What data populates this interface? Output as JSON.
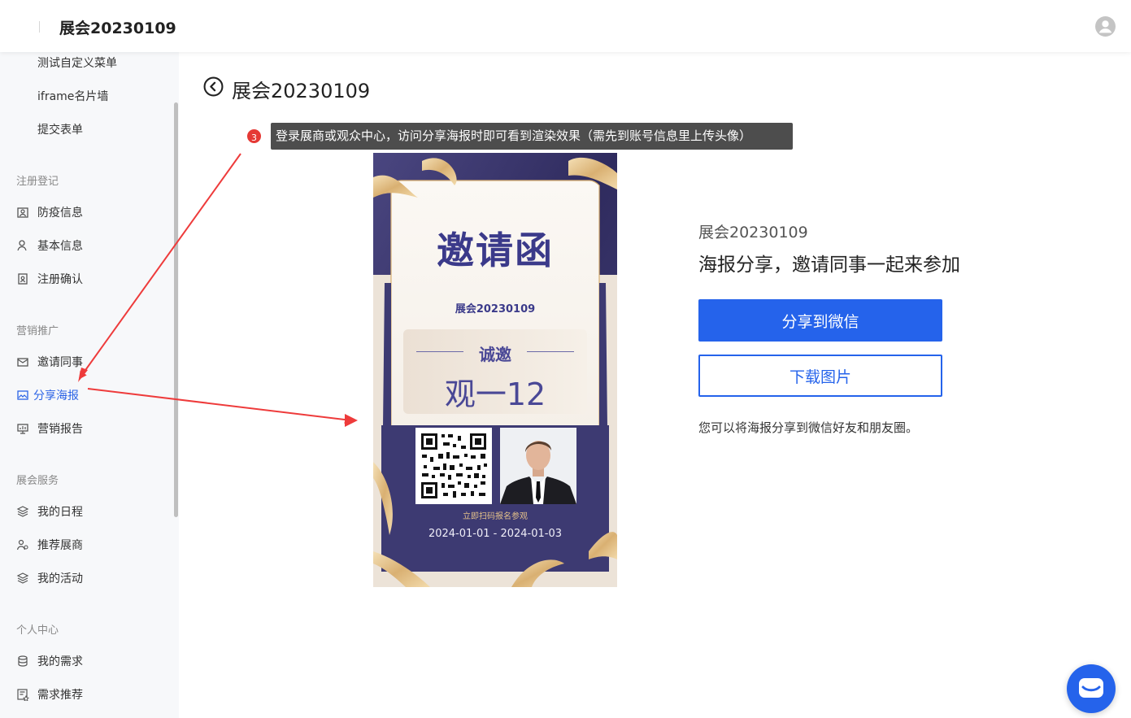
{
  "header": {
    "title": "展会20230109",
    "avatar_icon": "user-avatar-icon"
  },
  "sidebar": {
    "top_items": [
      {
        "label": "测试自定义菜单"
      },
      {
        "label": "iframe名片墙"
      },
      {
        "label": "提交表单"
      }
    ],
    "groups": [
      {
        "label": "注册登记",
        "items": [
          {
            "label": "防疫信息",
            "icon": "health-icon"
          },
          {
            "label": "基本信息",
            "icon": "user-icon"
          },
          {
            "label": "注册确认",
            "icon": "confirm-doc-icon"
          }
        ]
      },
      {
        "label": "营销推广",
        "items": [
          {
            "label": "邀请同事",
            "icon": "mail-icon"
          },
          {
            "label": "分享海报",
            "icon": "image-icon",
            "active": true
          },
          {
            "label": "营销报告",
            "icon": "report-icon"
          }
        ]
      },
      {
        "label": "展会服务",
        "items": [
          {
            "label": "我的日程",
            "icon": "layers-icon"
          },
          {
            "label": "推荐展商",
            "icon": "users-icon"
          },
          {
            "label": "我的活动",
            "icon": "layers-icon"
          }
        ]
      },
      {
        "label": "个人中心",
        "items": [
          {
            "label": "我的需求",
            "icon": "database-icon"
          },
          {
            "label": "需求推荐",
            "icon": "recommend-doc-icon"
          }
        ]
      }
    ]
  },
  "main": {
    "title": "展会20230109",
    "badge": "3",
    "tooltip": "登录展商或观众中心，访问分享海报时即可看到渲染效果（需先到账号信息里上传头像）"
  },
  "poster": {
    "heading": "邀请函",
    "event_name": "展会20230109",
    "invite_label": "诚邀",
    "guest_name": "观一12",
    "scan_text": "立即扫码报名参观",
    "date_range": "2024-01-01 - 2024-01-03"
  },
  "info": {
    "subtitle": "展会20230109",
    "title": "海报分享，邀请同事一起来参加",
    "share_button": "分享到微信",
    "download_button": "下载图片",
    "note": "您可以将海报分享到微信好友和朋友圈。"
  },
  "colors": {
    "accent": "#2563eb",
    "poster_navy": "#3d3a72",
    "ribbon_gold": "#e3c08a",
    "badge_red": "#e53935",
    "arrow_red": "#ee3b3b"
  }
}
